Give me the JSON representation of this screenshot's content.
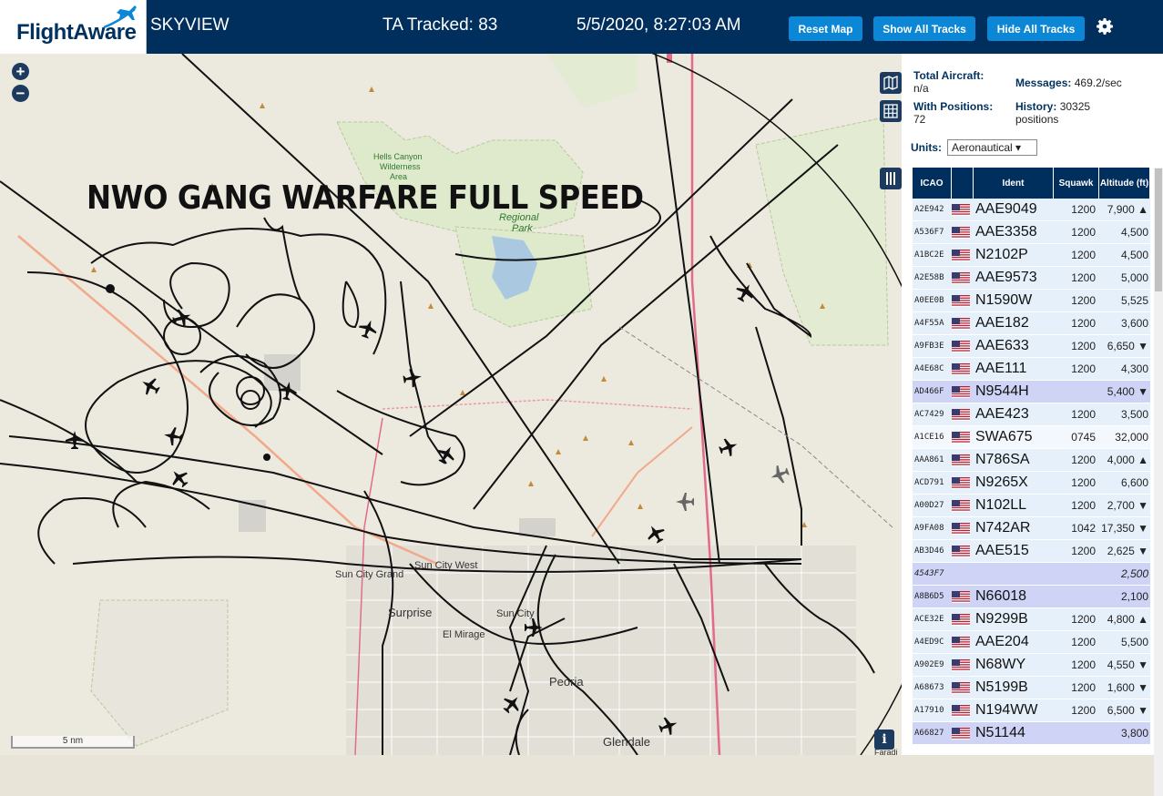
{
  "header": {
    "logo_text": "FlightAware",
    "title": "SKYVIEW",
    "tracked": "TA Tracked: 83",
    "datetime": "5/5/2020, 8:27:03 AM",
    "buttons": {
      "reset": "Reset Map",
      "show_all": "Show All Tracks",
      "hide_all": "Hide All Tracks"
    }
  },
  "map": {
    "overlay_text": "NWO GANG WARFARE FULL SPEED",
    "zoom_in": "+",
    "zoom_out": "−",
    "scale": "5 nm",
    "labels": {
      "park_top": "Hells Canyon",
      "park_mid": "Wilderness",
      "park_bot": "Area",
      "regional": "Regional",
      "park": "Park",
      "sun_city_grand": "Sun City Grand",
      "sun_city_west": "Sun City West",
      "surprise": "Surprise",
      "el_mirage": "El Mirage",
      "sun_city": "Sun City",
      "peoria": "Peoria",
      "glendale": "Glendale",
      "faradi": "Faradi"
    },
    "info": "i"
  },
  "stats": {
    "total_label": "Total Aircraft:",
    "total_value": "n/a",
    "messages_label": "Messages:",
    "messages_value": "469.2/sec",
    "positions_label": "With Positions:",
    "positions_value": "72",
    "history_label": "History:",
    "history_value": "30325",
    "history_unit": "positions"
  },
  "units": {
    "label": "Units:",
    "value": "Aeronautical ▾"
  },
  "table": {
    "headers": {
      "icao": "ICAO",
      "ident": "Ident",
      "squawk": "Squawk",
      "altitude": "Altitude (ft)"
    },
    "rows": [
      {
        "icao": "A2E942",
        "ident": "AAE9049",
        "squawk": "1200",
        "alt": "7,900 ▲",
        "style": "alt",
        "flag": true
      },
      {
        "icao": "A536F7",
        "ident": "AAE3358",
        "squawk": "1200",
        "alt": "4,500",
        "style": "alt",
        "flag": true
      },
      {
        "icao": "A1BC2E",
        "ident": "N2102P",
        "squawk": "1200",
        "alt": "4,500",
        "style": "alt",
        "flag": true
      },
      {
        "icao": "A2E58B",
        "ident": "AAE9573",
        "squawk": "1200",
        "alt": "5,000",
        "style": "alt",
        "flag": true
      },
      {
        "icao": "A0EE0B",
        "ident": "N1590W",
        "squawk": "1200",
        "alt": "5,525",
        "style": "alt",
        "flag": true
      },
      {
        "icao": "A4F55A",
        "ident": "AAE182",
        "squawk": "1200",
        "alt": "3,600",
        "style": "alt",
        "flag": true
      },
      {
        "icao": "A9FB3E",
        "ident": "AAE633",
        "squawk": "1200",
        "alt": "6,650 ▼",
        "style": "alt",
        "flag": true
      },
      {
        "icao": "A4E68C",
        "ident": "AAE111",
        "squawk": "1200",
        "alt": "4,300",
        "style": "alt",
        "flag": true
      },
      {
        "icao": "AD466F",
        "ident": "N9544H",
        "squawk": "",
        "alt": "5,400 ▼",
        "style": "sel",
        "flag": true
      },
      {
        "icao": "AC7429",
        "ident": "AAE423",
        "squawk": "1200",
        "alt": "3,500",
        "style": "alt",
        "flag": true
      },
      {
        "icao": "A1CE16",
        "ident": "SWA675",
        "squawk": "0745",
        "alt": "32,000",
        "style": "plain",
        "flag": true
      },
      {
        "icao": "AAA861",
        "ident": "N786SA",
        "squawk": "1200",
        "alt": "4,000 ▲",
        "style": "alt",
        "flag": true
      },
      {
        "icao": "ACD791",
        "ident": "N9265X",
        "squawk": "1200",
        "alt": "6,600",
        "style": "alt",
        "flag": true
      },
      {
        "icao": "A00D27",
        "ident": "N102LL",
        "squawk": "1200",
        "alt": "2,700 ▼",
        "style": "alt",
        "flag": true
      },
      {
        "icao": "A9FA08",
        "ident": "N742AR",
        "squawk": "1042",
        "alt": "17,350 ▼",
        "style": "alt",
        "flag": true
      },
      {
        "icao": "AB3D46",
        "ident": "AAE515",
        "squawk": "1200",
        "alt": "2,625 ▼",
        "style": "alt",
        "flag": true
      },
      {
        "icao": "4543F7",
        "ident": "",
        "squawk": "",
        "alt": "2,500",
        "style": "sel italic",
        "flag": false
      },
      {
        "icao": "A8B6D5",
        "ident": "N66018",
        "squawk": "",
        "alt": "2,100",
        "style": "sel",
        "flag": true
      },
      {
        "icao": "ACE32E",
        "ident": "N9299B",
        "squawk": "1200",
        "alt": "4,800 ▲",
        "style": "alt",
        "flag": true
      },
      {
        "icao": "A4ED9C",
        "ident": "AAE204",
        "squawk": "1200",
        "alt": "5,500",
        "style": "alt",
        "flag": true
      },
      {
        "icao": "A902E9",
        "ident": "N68WY",
        "squawk": "1200",
        "alt": "4,550 ▼",
        "style": "alt",
        "flag": true
      },
      {
        "icao": "A68673",
        "ident": "N5199B",
        "squawk": "1200",
        "alt": "1,600 ▼",
        "style": "alt",
        "flag": true
      },
      {
        "icao": "A17910",
        "ident": "N194WW",
        "squawk": "1200",
        "alt": "6,500 ▼",
        "style": "alt",
        "flag": true
      },
      {
        "icao": "A66827",
        "ident": "N51144",
        "squawk": "",
        "alt": "3,800",
        "style": "sel",
        "flag": true
      }
    ]
  },
  "colors": {
    "header_bg": "#002f5d",
    "button_bg": "#0b87d6",
    "track": "#111111",
    "road": "#e36b8a"
  }
}
